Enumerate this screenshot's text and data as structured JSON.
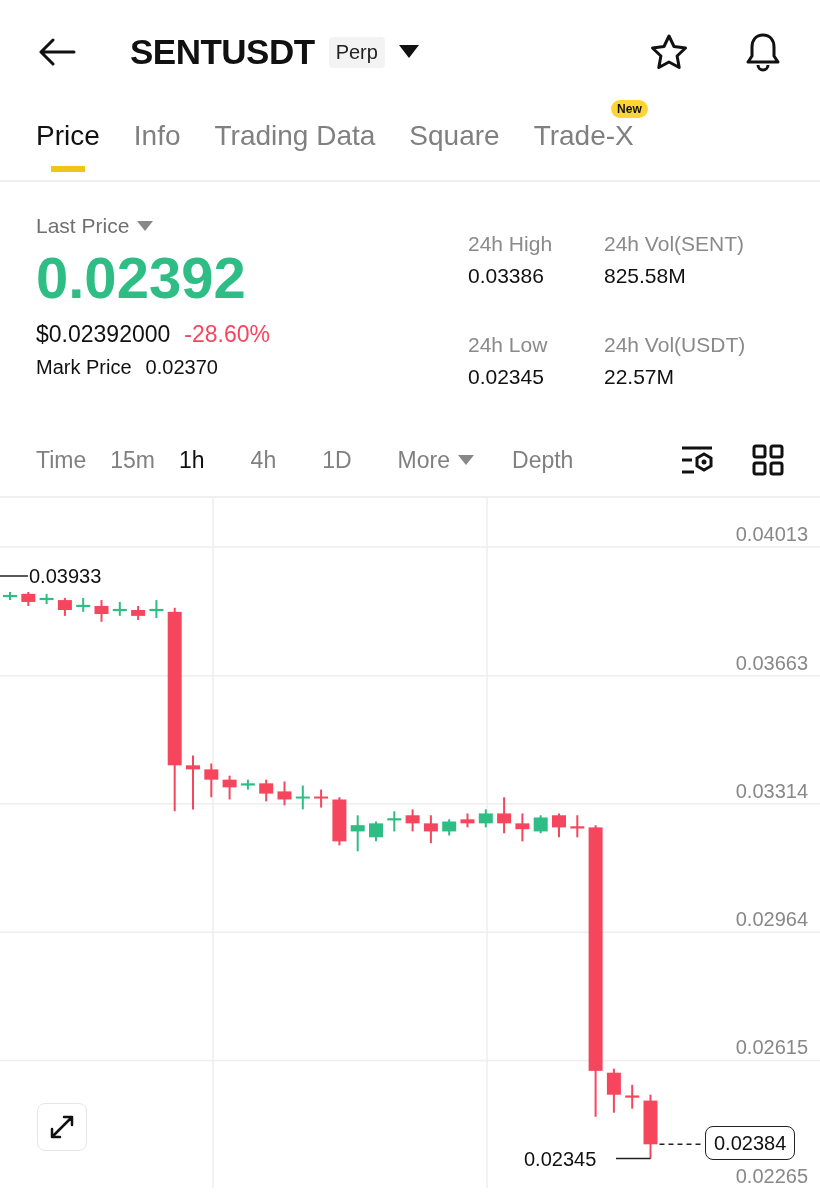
{
  "header": {
    "symbol": "SENTUSDT",
    "badge": "Perp"
  },
  "tabs": [
    {
      "label": "Price",
      "selected": true
    },
    {
      "label": "Info",
      "selected": false
    },
    {
      "label": "Trading Data",
      "selected": false
    },
    {
      "label": "Square",
      "selected": false
    },
    {
      "label": "Trade-X",
      "selected": false,
      "badge": "New"
    }
  ],
  "ticker": {
    "price_label": "Last Price",
    "last_price": "0.02392",
    "usd_price": "$0.02392000",
    "change": "-28.60%",
    "mark_label": "Mark Price",
    "mark_price": "0.02370"
  },
  "stats": [
    {
      "label": "24h High",
      "value": "0.03386"
    },
    {
      "label": "24h Vol(SENT)",
      "value": "825.58M"
    },
    {
      "label": "24h Low",
      "value": "0.02345"
    },
    {
      "label": "24h Vol(USDT)",
      "value": "22.57M"
    }
  ],
  "intervals": [
    {
      "label": "Time",
      "selected": false
    },
    {
      "label": "15m",
      "selected": false
    },
    {
      "label": "1h",
      "selected": true
    },
    {
      "label": "4h",
      "selected": false
    },
    {
      "label": "1D",
      "selected": false
    },
    {
      "label": "More",
      "selected": false,
      "kind": "menu"
    },
    {
      "label": "Depth",
      "selected": false
    }
  ],
  "chart": {
    "high_marker": "0.03933",
    "low_marker": "0.02345",
    "last_price_tag": "0.02384",
    "chart_data": {
      "type": "candlestick",
      "grid": true,
      "ylim": [
        0.02265,
        0.04144
      ],
      "ohlc": [
        [
          0.03874,
          0.03888,
          0.03866,
          0.0388
        ],
        [
          0.03883,
          0.03888,
          0.0385,
          0.03861
        ],
        [
          0.03866,
          0.03883,
          0.03855,
          0.03872
        ],
        [
          0.03866,
          0.03872,
          0.03823,
          0.03839
        ],
        [
          0.03847,
          0.03872,
          0.03834,
          0.03853
        ],
        [
          0.0385,
          0.03866,
          0.03807,
          0.03828
        ],
        [
          0.03836,
          0.03861,
          0.03823,
          0.03842
        ],
        [
          0.03839,
          0.0385,
          0.03812,
          0.03823
        ],
        [
          0.03836,
          0.03866,
          0.03817,
          0.03842
        ],
        [
          0.03834,
          0.03845,
          0.03291,
          0.03416
        ],
        [
          0.03416,
          0.03443,
          0.03296,
          0.03405
        ],
        [
          0.03405,
          0.03421,
          0.03329,
          0.03377
        ],
        [
          0.03377,
          0.03388,
          0.03323,
          0.03356
        ],
        [
          0.03361,
          0.03377,
          0.0335,
          0.03367
        ],
        [
          0.03367,
          0.03377,
          0.03318,
          0.03339
        ],
        [
          0.03345,
          0.03372,
          0.03307,
          0.03323
        ],
        [
          0.03326,
          0.03361,
          0.03296,
          0.03331
        ],
        [
          0.03331,
          0.0335,
          0.03301,
          0.03326
        ],
        [
          0.03323,
          0.03329,
          0.03198,
          0.03209
        ],
        [
          0.03236,
          0.0328,
          0.03182,
          0.03253
        ],
        [
          0.0322,
          0.03263,
          0.03209,
          0.03258
        ],
        [
          0.03266,
          0.03291,
          0.03236,
          0.03272
        ],
        [
          0.0328,
          0.03296,
          0.03236,
          0.03258
        ],
        [
          0.03258,
          0.0328,
          0.03204,
          0.03236
        ],
        [
          0.03236,
          0.03269,
          0.03225,
          0.03263
        ],
        [
          0.03269,
          0.03285,
          0.03247,
          0.03258
        ],
        [
          0.03258,
          0.03296,
          0.03247,
          0.03285
        ],
        [
          0.03285,
          0.03329,
          0.03231,
          0.03258
        ],
        [
          0.03258,
          0.03285,
          0.03209,
          0.03242
        ],
        [
          0.03236,
          0.0328,
          0.03231,
          0.03274
        ],
        [
          0.0328,
          0.03285,
          0.0322,
          0.03247
        ],
        [
          0.0325,
          0.0328,
          0.0322,
          0.03244
        ],
        [
          0.03247,
          0.03253,
          0.02459,
          0.02584
        ],
        [
          0.02579,
          0.0259,
          0.0247,
          0.02519
        ],
        [
          0.02517,
          0.02546,
          0.02481,
          0.02511
        ],
        [
          0.02503,
          0.02519,
          0.02345,
          0.02384
        ]
      ],
      "yticks": [
        0.04013,
        0.03663,
        0.03314,
        0.02964,
        0.02615,
        0.02265
      ]
    }
  }
}
